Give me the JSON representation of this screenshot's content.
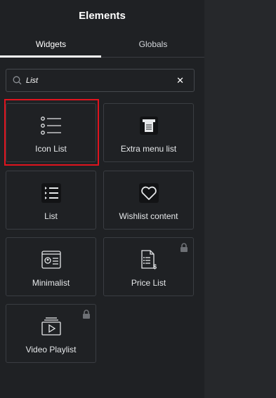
{
  "header": {
    "title": "Elements"
  },
  "tabs": [
    {
      "label": "Widgets"
    },
    {
      "label": "Globals"
    }
  ],
  "search": {
    "value": "List"
  },
  "widgets": [
    {
      "label": "Icon List",
      "icon": "icon-list-icon",
      "locked": false
    },
    {
      "label": "Extra menu list",
      "icon": "extra-menu-list-icon",
      "locked": false
    },
    {
      "label": "List",
      "icon": "list-icon",
      "locked": false
    },
    {
      "label": "Wishlist content",
      "icon": "heart-icon",
      "locked": false
    },
    {
      "label": "Minimalist",
      "icon": "minimalist-icon",
      "locked": false
    },
    {
      "label": "Price List",
      "icon": "price-list-icon",
      "locked": true
    },
    {
      "label": "Video Playlist",
      "icon": "video-playlist-icon",
      "locked": true
    }
  ],
  "colors": {
    "panel_bg": "#1f2124",
    "highlight": "#e0141e",
    "card_border": "#3a3d42",
    "text": "#e6e8ea"
  }
}
